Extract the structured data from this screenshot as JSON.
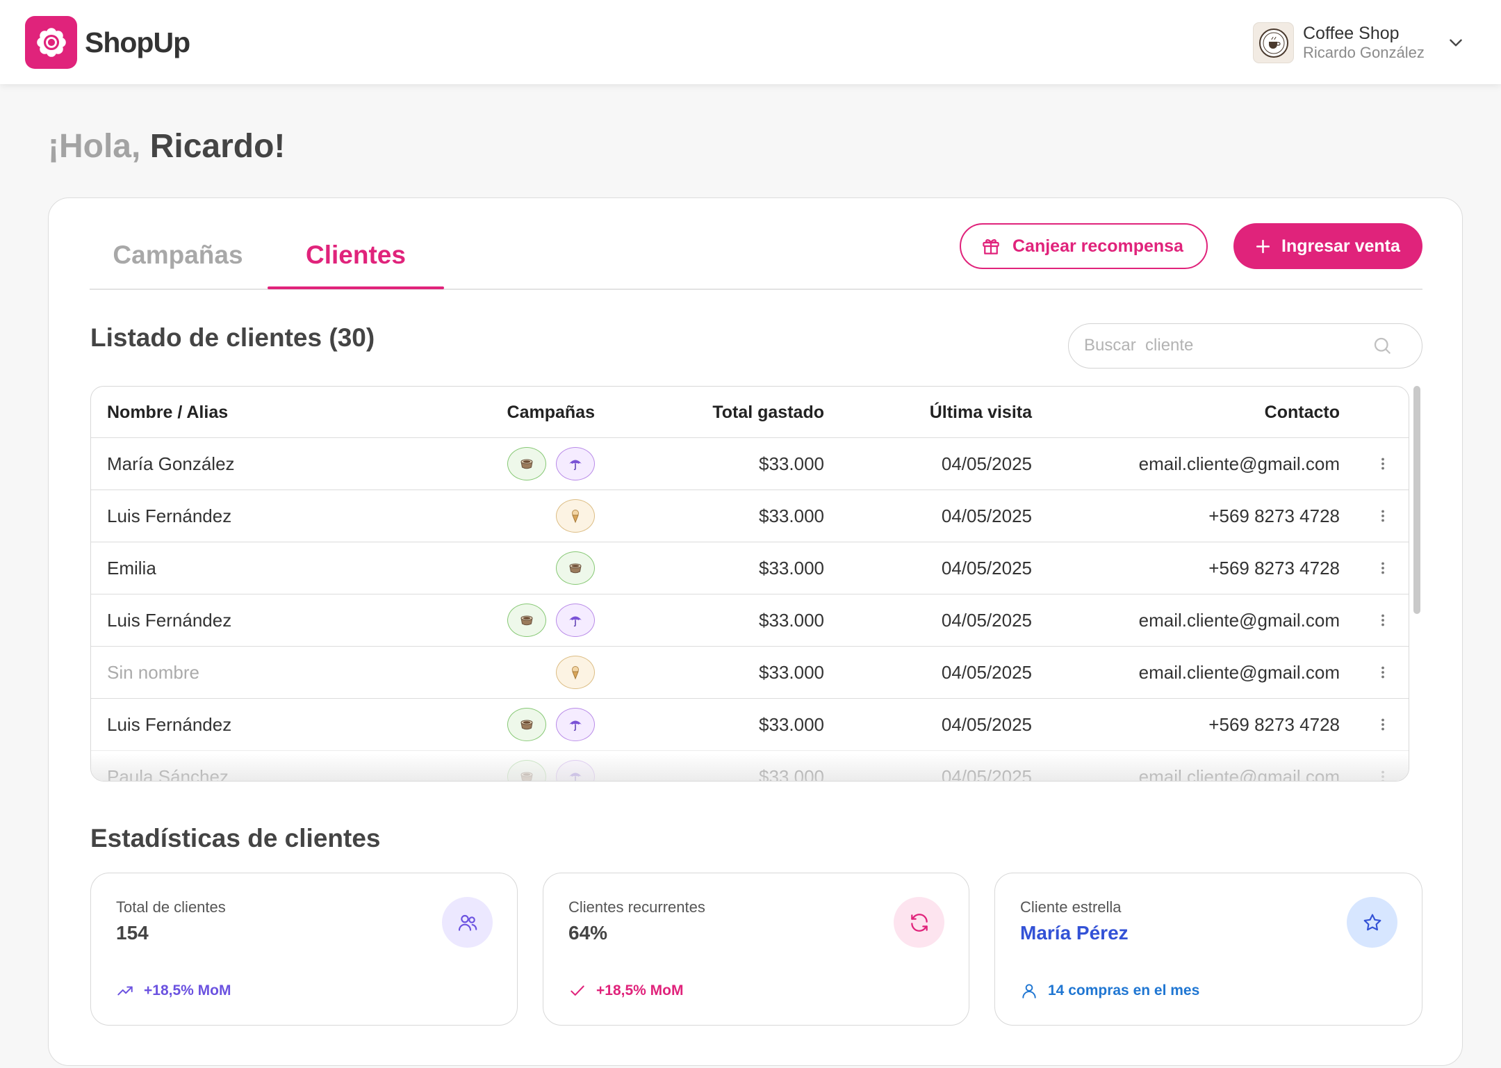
{
  "colors": {
    "brand": "#e0237b",
    "page_background": "#f7f7f7",
    "stat_total": "#6b52e0",
    "stat_recurring": "#e0237b",
    "stat_star": "#3352d6",
    "stat_star_footer": "#1f76d2"
  },
  "header": {
    "brand_name": "ShopUp",
    "logo_icon": "shopup-logo-icon",
    "shop_name": "Coffee Shop",
    "user_name": "Ricardo González",
    "shop_avatar_icon": "coffee-shop-logo-icon",
    "account_menu_icon": "chevron-down-icon"
  },
  "greeting": {
    "prefix": "¡Hola,",
    "name": "Ricardo!"
  },
  "tabs": [
    {
      "label": "Campañas",
      "active": false
    },
    {
      "label": "Clientes",
      "active": true
    }
  ],
  "actions": {
    "redeem": {
      "label": "Canjear recompensa",
      "icon": "gift-icon"
    },
    "new_sale": {
      "label": "Ingresar venta",
      "icon": "plus-icon"
    }
  },
  "clients": {
    "title": "Listado de clientes (30)",
    "search": {
      "placeholder": "Buscar  cliente",
      "value": "",
      "icon": "search-icon"
    },
    "columns": [
      "Nombre / Alias",
      "Campañas",
      "Total gastado",
      "Última visita",
      "Contacto"
    ],
    "row_menu_icon": "more-vertical-icon",
    "rows": [
      {
        "name": "María González",
        "unnamed": false,
        "campaigns": [
          "coffee-icon",
          "umbrella-icon"
        ],
        "total": "$33.000",
        "last_visit": "04/05/2025",
        "contact": "email.cliente@gmail.com"
      },
      {
        "name": "Luis Fernández",
        "unnamed": false,
        "campaigns": [
          "icecream-icon"
        ],
        "total": "$33.000",
        "last_visit": "04/05/2025",
        "contact": "+569 8273 4728"
      },
      {
        "name": "Emilia",
        "unnamed": false,
        "campaigns": [
          "coffee-icon"
        ],
        "total": "$33.000",
        "last_visit": "04/05/2025",
        "contact": "+569 8273 4728"
      },
      {
        "name": "Luis Fernández",
        "unnamed": false,
        "campaigns": [
          "coffee-icon",
          "umbrella-icon"
        ],
        "total": "$33.000",
        "last_visit": "04/05/2025",
        "contact": "email.cliente@gmail.com"
      },
      {
        "name": "Sin nombre",
        "unnamed": true,
        "campaigns": [
          "icecream-icon"
        ],
        "total": "$33.000",
        "last_visit": "04/05/2025",
        "contact": "email.cliente@gmail.com"
      },
      {
        "name": "Luis Fernández",
        "unnamed": false,
        "campaigns": [
          "coffee-icon",
          "umbrella-icon"
        ],
        "total": "$33.000",
        "last_visit": "04/05/2025",
        "contact": "+569 8273 4728"
      },
      {
        "name": "Paula Sánchez",
        "unnamed": false,
        "campaigns": [
          "coffee-icon",
          "umbrella-icon"
        ],
        "total": "$33.000",
        "last_visit": "04/05/2025",
        "contact": "email.cliente@gmail.com"
      }
    ]
  },
  "stats": {
    "title": "Estadísticas de clientes",
    "cards": [
      {
        "label": "Total de clientes",
        "value": "154",
        "icon": "users-icon",
        "footer_icon": "trending-up-icon",
        "footer": "+18,5% MoM"
      },
      {
        "label": "Clientes recurrentes",
        "value": "64%",
        "icon": "refresh-icon",
        "footer_icon": "check-icon",
        "footer": "+18,5% MoM"
      },
      {
        "label": "Cliente estrella",
        "value": "María Pérez",
        "icon": "star-icon",
        "footer_icon": "user-icon",
        "footer": "14 compras en el mes"
      }
    ]
  }
}
